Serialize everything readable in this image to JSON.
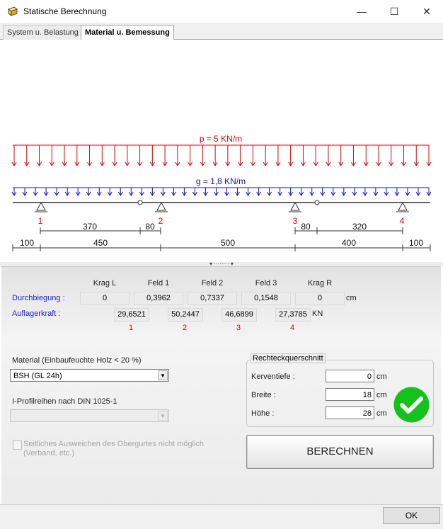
{
  "window": {
    "title": "Statische Berechnung",
    "minimize_glyph": "—",
    "maximize_glyph": "☐",
    "close_glyph": "✕"
  },
  "tabs": [
    {
      "label": "System u. Belastung",
      "active": false
    },
    {
      "label": "Material u. Bemessung",
      "active": true
    }
  ],
  "diagram": {
    "p_label": "p = 5 KN/m",
    "g_label": "g = 1,8 KN/m",
    "support_labels": [
      "1",
      "2",
      "3",
      "4"
    ],
    "upper_dims": [
      "370",
      "80",
      "80",
      "320"
    ],
    "lower_dims": [
      "100",
      "450",
      "500",
      "400",
      "100"
    ],
    "colors": {
      "p_load": "#e00000",
      "g_load": "#1010d0",
      "beam": "#333333"
    }
  },
  "results": {
    "columns": [
      "Krag L",
      "Feld 1",
      "Feld 2",
      "Feld 3",
      "Krag R"
    ],
    "deflection_label": "Durchbiegung :",
    "deflection_values": [
      "0",
      "0,3962",
      "0,7337",
      "0,1548",
      "0"
    ],
    "deflection_unit": "cm",
    "support_force_label": "Auflagerkraft :",
    "support_force_values": [
      "29,6521",
      "50,2447",
      "46,6899",
      "27,3785"
    ],
    "support_force_unit": "KN",
    "support_numbers": [
      "1",
      "2",
      "3",
      "4"
    ]
  },
  "material": {
    "label": "Material (Einbaufeuchte Holz < 20 %)",
    "selected": "BSH (GL 24h)"
  },
  "profile": {
    "label": "I-Profilreihen nach DIN 1025-1",
    "selected": ""
  },
  "option": {
    "checkbox_label": "Seitliches Ausweichen des Obergurtes nicht möglich (Verband, etc.)",
    "checked": false
  },
  "section": {
    "title": "Rechteckquerschnitt",
    "fields": [
      {
        "label": "Kerventiefe :",
        "value": "0",
        "unit": "cm"
      },
      {
        "label": "Breite :",
        "value": "18",
        "unit": "cm"
      },
      {
        "label": "Höhe :",
        "value": "28",
        "unit": "cm"
      }
    ],
    "status_color": "#15c21b"
  },
  "calculate_button": "BERECHNEN",
  "ok_button": "OK"
}
